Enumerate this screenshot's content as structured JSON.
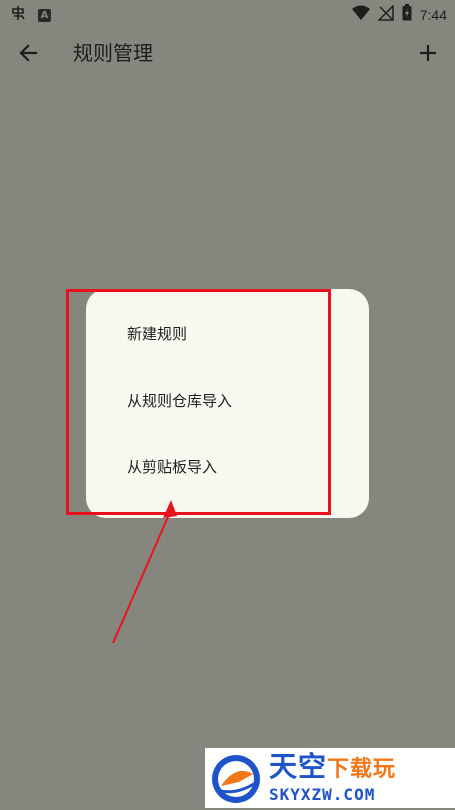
{
  "status_bar": {
    "left_icons": [
      "app-notification-icon",
      "a-badge-icon"
    ],
    "right_icons": [
      "wifi-icon",
      "signal-icon",
      "battery-charging-icon"
    ],
    "time": "7:44"
  },
  "toolbar": {
    "title": "规则管理",
    "back_icon": "arrow-left-icon",
    "add_icon": "plus-icon"
  },
  "menu": {
    "items": [
      {
        "label": "新建规则"
      },
      {
        "label": "从规则仓库导入"
      },
      {
        "label": "从剪贴板导入"
      }
    ]
  },
  "annotation": {
    "color": "#e8141c"
  },
  "watermark": {
    "title_main": "天空",
    "title_accent": "下载玩",
    "url": "SKYXZW.COM"
  },
  "colors": {
    "scrim_background": "#85877f",
    "menu_background": "#f7f8ef",
    "text": "#1c1c1a"
  }
}
